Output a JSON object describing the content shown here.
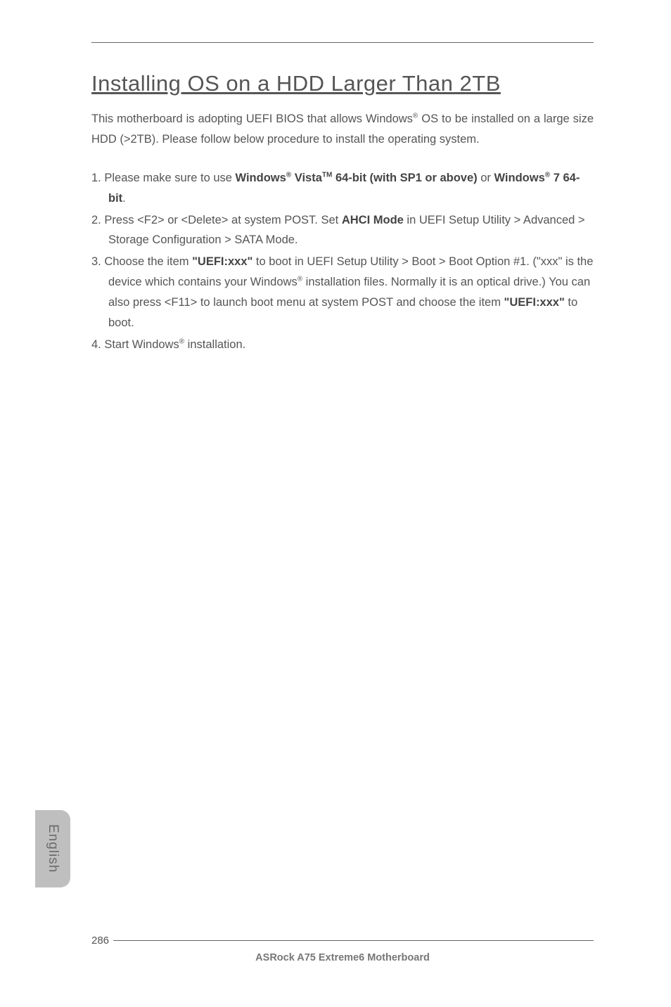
{
  "title": "Installing OS on a HDD Larger Than 2TB",
  "intro_part1": "This motherboard is adopting UEFI BIOS that allows Windows",
  "intro_part2": " OS to be installed on a large size HDD (>2TB). Please follow below procedure to install the operating system.",
  "steps": {
    "s1_a": "1. Please make sure to use ",
    "s1_bold1": "Windows",
    "s1_bold2": " Vista",
    "s1_bold3": " 64-bit (with SP1 or above)",
    "s1_b": " or ",
    "s1_bold4": "Windows",
    "s1_bold5": " 7 64-bit",
    "s1_c": ".",
    "s2_a": "2. Press <F2> or <Delete> at system POST. Set ",
    "s2_bold": "AHCI Mode",
    "s2_b": " in UEFI Setup Utility > Advanced > Storage Configuration > SATA Mode.",
    "s3_a": "3. Choose the item ",
    "s3_bold1": "\"UEFI:xxx\"",
    "s3_b": " to boot in UEFI Setup Utility > Boot > Boot Option #1. (\"xxx\" is the device which contains your Windows",
    "s3_c": " installation files. Normally it is an optical drive.) You can also press <F11> to launch boot menu at system POST and choose the item ",
    "s3_bold2": "\"UEFI:xxx\"",
    "s3_d": " to boot.",
    "s4_a": "4. Start Windows",
    "s4_b": " installation."
  },
  "sup_r": "®",
  "sup_tm": "TM",
  "side_tab": "English",
  "page_number": "286",
  "footer_title": "ASRock  A75 Extreme6  Motherboard",
  "chart_data": null
}
